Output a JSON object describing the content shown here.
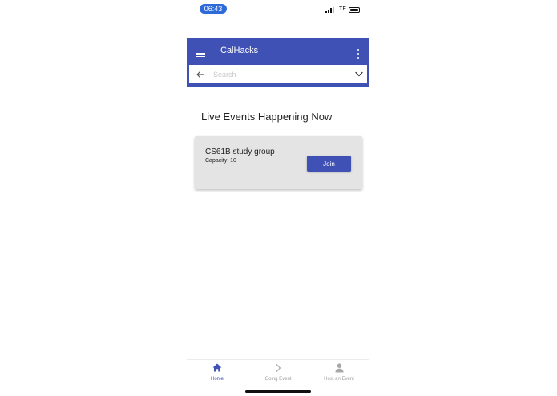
{
  "status_bar": {
    "time": "06:43",
    "network": "LTE",
    "icons": [
      "signal-icon",
      "battery-icon"
    ]
  },
  "app_bar": {
    "title": "CalHacks",
    "color": "#3f51b5",
    "icons": [
      "menu-icon",
      "more-icon"
    ]
  },
  "search": {
    "placeholder": "Search",
    "value": "",
    "icons": [
      "back-icon",
      "chevron-down-icon"
    ]
  },
  "main": {
    "section_title": "Live Events Happening Now",
    "events": [
      {
        "name": "CS61B study group",
        "capacity": "Capacity: 10",
        "join_label": "Join"
      }
    ]
  },
  "bottom_nav": {
    "active_color": "#3f51b5",
    "items": [
      {
        "label": "Home",
        "icon": "home-icon",
        "active": true
      },
      {
        "label": "Going Event",
        "icon": "chevron-right-icon",
        "active": false
      },
      {
        "label": "Host an Event",
        "icon": "person-icon",
        "active": false
      }
    ]
  }
}
